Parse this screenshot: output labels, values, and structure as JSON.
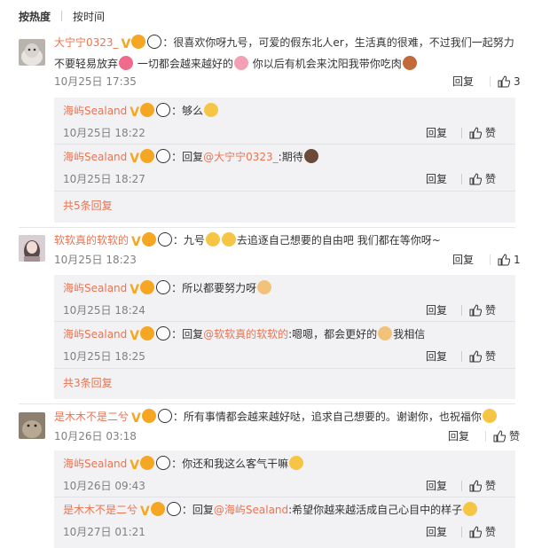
{
  "sort": {
    "hot": "按热度",
    "time": "按时间"
  },
  "comments": [
    {
      "user": "大宁宁0323_",
      "vip": "V",
      "text_a": "：很喜欢你呀九号，可爱的假东北人er，生活真的很难，不过我们一起努力",
      "text_b": "不要轻易放弃",
      "text_c": "一切都会越来越好的",
      "text_d": "你以后有机会来沈阳我带你吃肉",
      "time": "10月25日 17:35",
      "reply": "回复",
      "likes": "3",
      "subs": [
        {
          "user": "海屿Sealand",
          "vip": "V",
          "text": "：够么",
          "time": "10月25日 18:22",
          "reply": "回复",
          "like": "赞"
        },
        {
          "user": "海屿Sealand",
          "vip": "V",
          "prefix": "：回复",
          "mention": "@大宁宁0323_",
          "text": ":期待",
          "time": "10月25日 18:27",
          "reply": "回复",
          "like": "赞"
        }
      ],
      "more": "共5条回复"
    },
    {
      "user": "软软真的软软的",
      "vip": "V",
      "text_a": "：九号",
      "text_b": "去追逐自己想要的自由吧 我们都在等你呀~",
      "time": "10月25日 18:23",
      "reply": "回复",
      "likes": "1",
      "subs": [
        {
          "user": "海屿Sealand",
          "vip": "V",
          "text": "：所以都要努力呀",
          "time": "10月25日 18:24",
          "reply": "回复",
          "like": "赞"
        },
        {
          "user": "海屿Sealand",
          "vip": "V",
          "prefix": "：回复",
          "mention": "@软软真的软软的",
          "text": ":嗯嗯，都会更好的",
          "text2": "我相信",
          "time": "10月25日 18:25",
          "reply": "回复",
          "like": "赞"
        }
      ],
      "more": "共3条回复"
    },
    {
      "user": "是木木不是二兮",
      "vip": "V",
      "text_a": "：所有事情都会越来越好哒，追求自己想要的。谢谢你，也祝福你",
      "time": "10月26日 03:18",
      "reply": "回复",
      "like": "赞",
      "subs": [
        {
          "user": "海屿Sealand",
          "vip": "V",
          "text": "：你还和我这么客气干嘛",
          "time": "10月26日 09:43",
          "reply": "回复",
          "like": "赞"
        },
        {
          "user": "是木木不是二兮",
          "vip": "V",
          "prefix": "：回复",
          "mention": "@海屿Sealand",
          "text": ":希望你越来越活成自己心目中的样子",
          "time": "10月27日 01:21",
          "reply": "回复",
          "like": "赞"
        }
      ]
    }
  ]
}
